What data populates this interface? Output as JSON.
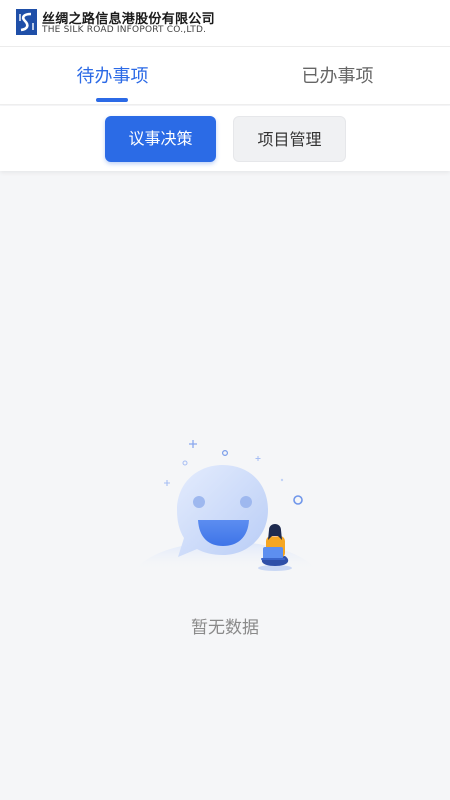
{
  "header": {
    "logo_icon": "silk-road-logo-icon",
    "company_name_cn": "丝绸之路信息港股份有限公司",
    "company_name_en": "THE SILK ROAD INFOPORT CO.,LTD."
  },
  "tabs": [
    {
      "label": "待办事项",
      "active": true
    },
    {
      "label": "已办事项",
      "active": false
    }
  ],
  "segments": [
    {
      "label": "议事决策",
      "active": true
    },
    {
      "label": "项目管理",
      "active": false
    }
  ],
  "empty_state": {
    "icon": "empty-chat-illustration",
    "text": "暂无数据"
  },
  "colors": {
    "accent": "#2c6ae6",
    "background": "#f5f6f8"
  }
}
